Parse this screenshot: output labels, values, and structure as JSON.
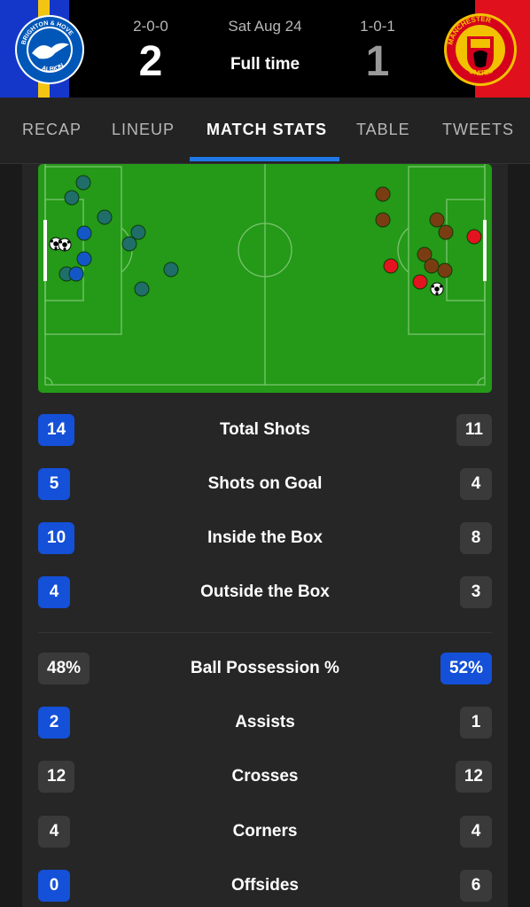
{
  "header": {
    "home": {
      "record": "2-0-0",
      "score": "2",
      "logo_icon": "brighton-crest-icon",
      "crest_text": "BRIGHTON & HOVE",
      "crest_subtext": "ALBION"
    },
    "away": {
      "record": "1-0-1",
      "score": "1",
      "logo_icon": "manchester-united-crest-icon",
      "crest_text": "MANCHESTER",
      "crest_subtext": "UNITED"
    },
    "date": "Sat Aug 24",
    "status": "Full time"
  },
  "tabs": [
    {
      "label": "RECAP",
      "active": false
    },
    {
      "label": "LINEUP",
      "active": false
    },
    {
      "label": "MATCH STATS",
      "active": true
    },
    {
      "label": "TABLE",
      "active": false
    },
    {
      "label": "TWEETS",
      "active": false
    }
  ],
  "shot_map": {
    "home_off_target_color": "#1f6e6a",
    "home_on_target_color": "#1357c6",
    "away_off_target_color": "#7a3d12",
    "away_on_target_color": "#e3131f",
    "pitch_color": "#249a18"
  },
  "stats": [
    {
      "label": "Total Shots",
      "home": "14",
      "away": "11",
      "leader": "home"
    },
    {
      "label": "Shots on Goal",
      "home": "5",
      "away": "4",
      "leader": "home"
    },
    {
      "label": "Inside the Box",
      "home": "10",
      "away": "8",
      "leader": "home"
    },
    {
      "label": "Outside the Box",
      "home": "4",
      "away": "3",
      "leader": "home"
    },
    {
      "label": "Ball Possession %",
      "home": "48%",
      "away": "52%",
      "leader": "away"
    },
    {
      "label": "Assists",
      "home": "2",
      "away": "1",
      "leader": "home"
    },
    {
      "label": "Crosses",
      "home": "12",
      "away": "12",
      "leader": "none"
    },
    {
      "label": "Corners",
      "home": "4",
      "away": "4",
      "leader": "none"
    },
    {
      "label": "Offsides",
      "home": "0",
      "away": "6",
      "leader": "home"
    }
  ]
}
